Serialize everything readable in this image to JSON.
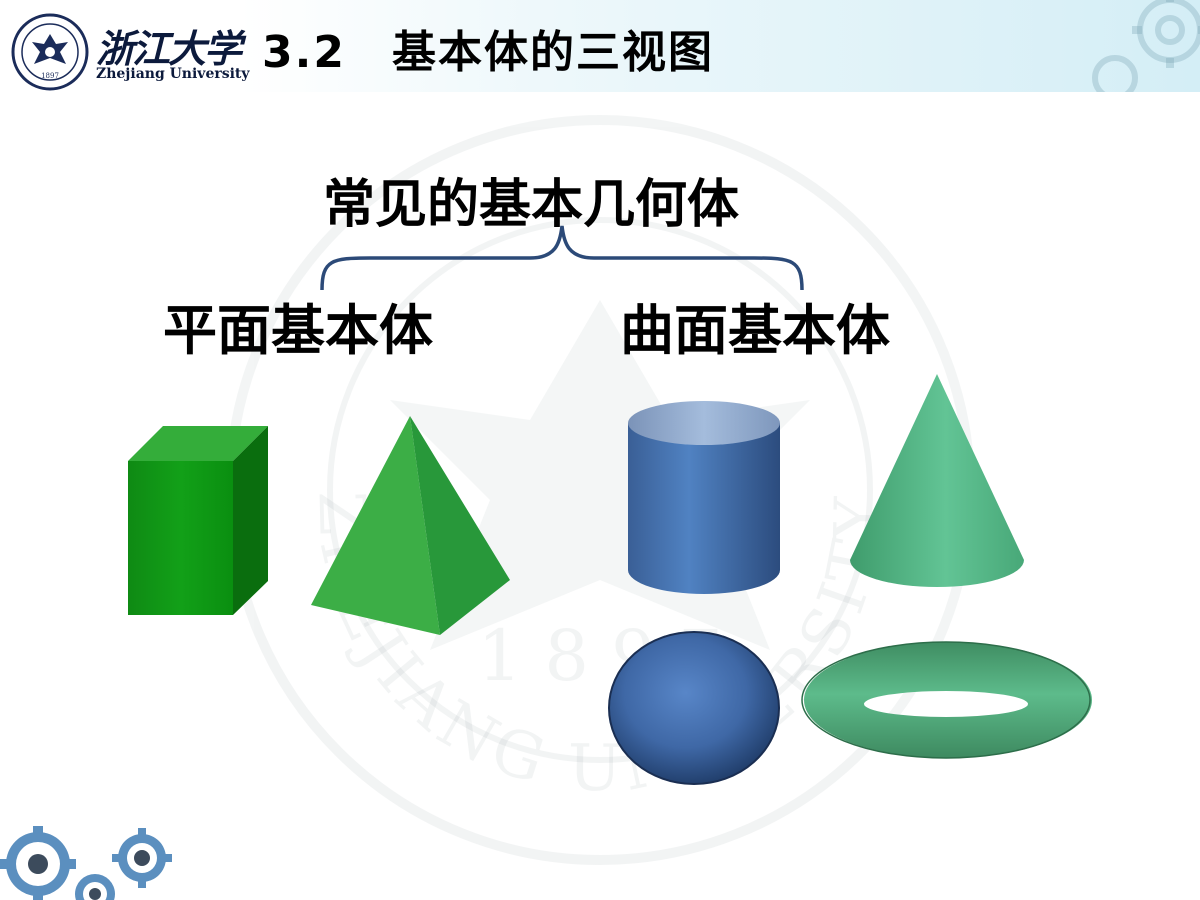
{
  "header": {
    "logo_cn": "浙江大学",
    "logo_en": "Zhejiang University",
    "title": "3.2　基本体的三视图"
  },
  "main": {
    "heading": "常见的基本几何体",
    "left_label": "平面基本体",
    "right_label": "曲面基本体"
  },
  "watermark": {
    "text": "ZHEJIANG UNIVERSITY",
    "year": "1 8 9 7"
  },
  "colors": {
    "prism_front": "#0a9a12",
    "prism_side": "#0a7a10",
    "prism_top": "#2fae35",
    "pyramid_left": "#3fb34a",
    "pyramid_right": "#2a9a34",
    "pyramid_base": "#1f8a26",
    "cylinder_body": "#4a74b4",
    "cylinder_top": "#8fa9cf",
    "cone": "#5fc090",
    "sphere": "#4a76b8",
    "torus": "#54ad80",
    "brace": "#2c4a78"
  }
}
